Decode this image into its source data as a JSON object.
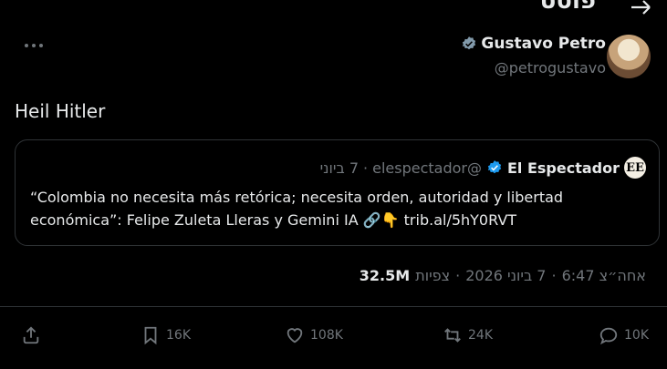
{
  "header": {
    "title": "פוסט"
  },
  "author": {
    "name": "Gustavo Petro",
    "handle": "@petrogustavo"
  },
  "post": {
    "text": "Heil Hitler"
  },
  "quote": {
    "logo_text": "EE",
    "name": "El Espectador",
    "handle": "@elespectador",
    "separator": "·",
    "date": "7 ביוני",
    "text": "“Colombia no necesita más retórica; necesita orden, autoridad y libertad económica”: Felipe Zuleta Lleras y Gemini IA 🔗👇 trib.al/5hY0RVT"
  },
  "meta": {
    "time": "אחה״צ 6:47",
    "date": "7 ביוני 2026",
    "views_count": "32.5M",
    "views_label": "צפיות",
    "separator": "·"
  },
  "actions": {
    "replies": "10K",
    "retweets": "24K",
    "likes": "108K",
    "bookmarks": "16K"
  },
  "colors": {
    "background": "#000000",
    "text": "#e7e9ea",
    "muted": "#71767b",
    "verified_blue": "#1d9bf0",
    "border": "#2f3336"
  }
}
